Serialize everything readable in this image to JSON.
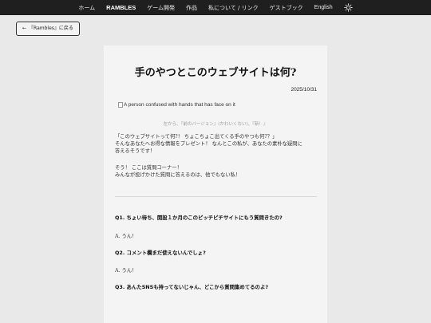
{
  "nav": {
    "items": [
      "ホーム",
      "RAMBLES",
      "ゲーム開発",
      "作品",
      "私について / リンク",
      "ゲストブック",
      "English"
    ],
    "active": "RAMBLES",
    "theme_icon": "sun-icon"
  },
  "back_button": {
    "arrow": "←",
    "label": "『Rambles』に戻る"
  },
  "article": {
    "title": "手のやつとこのウェブサイトは何?",
    "date": "2025/10/31",
    "image_alt": "A person confused with hands that has face on it",
    "caption": "左から、『前のバージョン』(かわいくない)、『新！』",
    "intro_lines": [
      "「このウェブサイトって何?！ ちょこちょこ出てくる手のやつも何?？」",
      "そんなあなたへお得な情報をプレゼント！ なんとこの私が、あなたの素朴な疑問に",
      "答えるそうです！"
    ],
    "intro2_lines": [
      "そう！ ここは質問コーナー！",
      "みんなが投げかけた質問に答えるのは、他でもない私！"
    ]
  },
  "qa": [
    {
      "q": "Q1. ちょい待ち、開設１か月のこのピッチピチサイトにもう質問きたの?",
      "a": "A. うん！"
    },
    {
      "q": "Q2. コメント欄まだ使えないんでしょ?",
      "a": "A. うん！"
    },
    {
      "q": "Q3. あんたSNSも持ってないじゃん、どこから質問集めてるのよ?",
      "a": ""
    }
  ]
}
